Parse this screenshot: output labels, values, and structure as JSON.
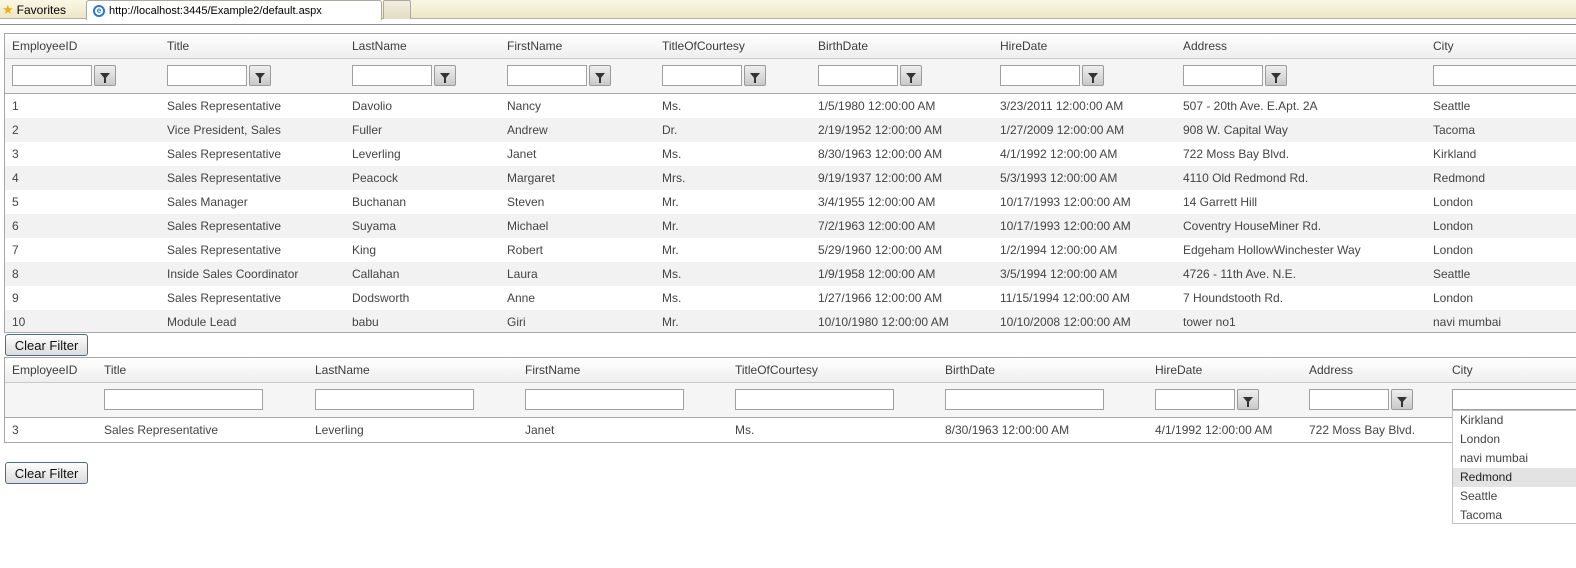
{
  "browser": {
    "favorites_label": "Favorites",
    "tab_url": "http://localhost:3445/Example2/default.aspx"
  },
  "grid1": {
    "columns": [
      "EmployeeID",
      "Title",
      "LastName",
      "FirstName",
      "TitleOfCourtesy",
      "BirthDate",
      "HireDate",
      "Address",
      "City"
    ],
    "rows": [
      [
        "1",
        "Sales Representative",
        "Davolio",
        "Nancy",
        "Ms.",
        "1/5/1980 12:00:00 AM",
        "3/23/2011 12:00:00 AM",
        "507 - 20th Ave. E.Apt. 2A",
        "Seattle"
      ],
      [
        "2",
        "Vice President, Sales",
        "Fuller",
        "Andrew",
        "Dr.",
        "2/19/1952 12:00:00 AM",
        "1/27/2009 12:00:00 AM",
        "908 W. Capital Way",
        "Tacoma"
      ],
      [
        "3",
        "Sales Representative",
        "Leverling",
        "Janet",
        "Ms.",
        "8/30/1963 12:00:00 AM",
        "4/1/1992 12:00:00 AM",
        "722 Moss Bay Blvd.",
        "Kirkland"
      ],
      [
        "4",
        "Sales Representative",
        "Peacock",
        "Margaret",
        "Mrs.",
        "9/19/1937 12:00:00 AM",
        "5/3/1993 12:00:00 AM",
        "4110 Old Redmond Rd.",
        "Redmond"
      ],
      [
        "5",
        "Sales Manager",
        "Buchanan",
        "Steven",
        "Mr.",
        "3/4/1955 12:00:00 AM",
        "10/17/1993 12:00:00 AM",
        "14 Garrett Hill",
        "London"
      ],
      [
        "6",
        "Sales Representative",
        "Suyama",
        "Michael",
        "Mr.",
        "7/2/1963 12:00:00 AM",
        "10/17/1993 12:00:00 AM",
        "Coventry HouseMiner Rd.",
        "London"
      ],
      [
        "7",
        "Sales Representative",
        "King",
        "Robert",
        "Mr.",
        "5/29/1960 12:00:00 AM",
        "1/2/1994 12:00:00 AM",
        "Edgeham HollowWinchester Way",
        "London"
      ],
      [
        "8",
        "Inside Sales Coordinator",
        "Callahan",
        "Laura",
        "Ms.",
        "1/9/1958 12:00:00 AM",
        "3/5/1994 12:00:00 AM",
        "4726 - 11th Ave. N.E.",
        "Seattle"
      ],
      [
        "9",
        "Sales Representative",
        "Dodsworth",
        "Anne",
        "Ms.",
        "1/27/1966 12:00:00 AM",
        "11/15/1994 12:00:00 AM",
        "7 Houndstooth Rd.",
        "London"
      ],
      [
        "10",
        "Module Lead",
        "babu",
        "Giri",
        "Mr.",
        "10/10/1980 12:00:00 AM",
        "10/10/2008 12:00:00 AM",
        "tower no1",
        "navi mumbai"
      ]
    ],
    "clear_filter_label": "Clear Filter"
  },
  "grid2": {
    "columns": [
      "EmployeeID",
      "Title",
      "LastName",
      "FirstName",
      "TitleOfCourtesy",
      "BirthDate",
      "HireDate",
      "Address",
      "City"
    ],
    "rows": [
      [
        "3",
        "Sales Representative",
        "Leverling",
        "Janet",
        "Ms.",
        "8/30/1963 12:00:00 AM",
        "4/1/1992 12:00:00 AM",
        "722 Moss Bay Blvd.",
        ""
      ]
    ],
    "clear_filter_label": "Clear Filter"
  },
  "city_dropdown": {
    "options": [
      "Kirkland",
      "London",
      "navi mumbai",
      "Redmond",
      "Seattle",
      "Tacoma"
    ],
    "highlighted": "Redmond"
  }
}
